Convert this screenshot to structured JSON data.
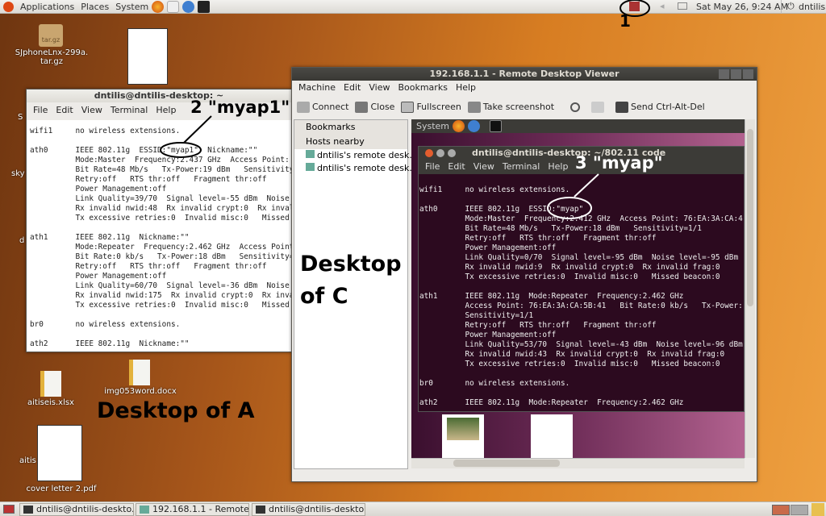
{
  "top_panel": {
    "menus": [
      "Applications",
      "Places",
      "System"
    ],
    "clock": "Sat May 26,  9:24 AM",
    "user": "dntilis"
  },
  "desktop": {
    "icons": [
      {
        "label": "SJphoneLnx-299a.\ntar.gz",
        "glyph": "tar.gz"
      },
      {
        "label": "aitiseis.xlsx"
      },
      {
        "label": "img053word.docx"
      },
      {
        "label": "cover letter 2.pdf"
      }
    ],
    "partial_labels": [
      "S",
      "sky",
      "d",
      "aitis"
    ]
  },
  "terminal_a": {
    "title": "dntilis@dntilis-desktop: ~",
    "menu": [
      "File",
      "Edit",
      "View",
      "Terminal",
      "Help"
    ],
    "lines": [
      "wifi1     no wireless extensions.",
      "",
      "ath0      IEEE 802.11g  ESSID:\"myap1\"  Nickname:\"\"",
      "          Mode:Master  Frequency:2.437 GHz  Access Point:",
      "          Bit Rate=48 Mb/s   Tx-Power:19 dBm   Sensitivity",
      "          Retry:off   RTS thr:off   Fragment thr:off",
      "          Power Management:off",
      "          Link Quality=39/70  Signal level=-55 dBm  Noise",
      "          Rx invalid nwid:48  Rx invalid crypt:0  Rx inval",
      "          Tx excessive retries:0  Invalid misc:0   Missed",
      "",
      "ath1      IEEE 802.11g  Nickname:\"\"",
      "          Mode:Repeater  Frequency:2.462 GHz  Access Point",
      "          Bit Rate:0 kb/s   Tx-Power:18 dBm   Sensitivity=",
      "          Retry:off   RTS thr:off   Fragment thr:off",
      "          Power Management:off",
      "          Link Quality=60/70  Signal level=-36 dBm  Noise",
      "          Rx invalid nwid:175  Rx invalid crypt:0  Rx inva",
      "          Tx excessive retries:0  Invalid misc:0   Missed",
      "",
      "br0       no wireless extensions.",
      "",
      "ath2      IEEE 802.11g  Nickname:\"\""
    ]
  },
  "viewer": {
    "title": "192.168.1.1 - Remote Desktop Viewer",
    "menu": [
      "Machine",
      "Edit",
      "View",
      "Bookmarks",
      "Help"
    ],
    "toolbar": [
      "Connect",
      "Close",
      "Fullscreen",
      "Take screenshot",
      "Send Ctrl-Alt-Del"
    ],
    "sidebar": {
      "headers": [
        "Bookmarks",
        "Hosts nearby"
      ],
      "hosts": [
        "dntilis's remote desk...",
        "dntilis's remote desk..."
      ]
    },
    "remote_panel": {
      "menu": "System"
    },
    "remote_terminal": {
      "title": "dntilis@dntilis-desktop: ~/802.11 code",
      "menu": [
        "File",
        "Edit",
        "View",
        "Terminal",
        "Help"
      ],
      "lines": [
        "wifi1     no wireless extensions.",
        "",
        "ath0      IEEE 802.11g  ESSID:\"myap\"",
        "          Mode:Master  Frequency:2.412 GHz  Access Point: 76:EA:3A:CA:4",
        "          Bit Rate=48 Mb/s   Tx-Power:18 dBm   Sensitivity=1/1",
        "          Retry:off   RTS thr:off   Fragment thr:off",
        "          Power Management:off",
        "          Link Quality=0/70  Signal level=-95 dBm  Noise level=-95 dBm",
        "          Rx invalid nwid:9  Rx invalid crypt:0  Rx invalid frag:0",
        "          Tx excessive retries:0  Invalid misc:0   Missed beacon:0",
        "",
        "ath1      IEEE 802.11g  Mode:Repeater  Frequency:2.462 GHz",
        "          Access Point: 76:EA:3A:CA:5B:41   Bit Rate:0 kb/s   Tx-Power:",
        "          Sensitivity=1/1",
        "          Retry:off   RTS thr:off   Fragment thr:off",
        "          Power Management:off",
        "          Link Quality=53/70  Signal level=-43 dBm  Noise level=-96 dBm",
        "          Rx invalid nwid:43  Rx invalid crypt:0  Rx invalid frag:0",
        "          Tx excessive retries:0  Invalid misc:0   Missed beacon:0",
        "",
        "br0       no wireless extensions.",
        "",
        "ath2      IEEE 802.11g  Mode:Repeater  Frequency:2.462 GHz"
      ]
    }
  },
  "annotations": {
    "a1": "1",
    "a2": "2 \"myap1\"",
    "a3": "3 \"myap\"",
    "desktop_c": "Desktop\nof C",
    "desktop_a": "Desktop of A"
  },
  "taskbar": [
    "dntilis@dntilis-deskto...",
    "192.168.1.1 - Remote ...",
    "dntilis@dntilis-deskto..."
  ],
  "colors": {
    "terminal_bg": "#2c0a1f",
    "panel": "#3c3b37",
    "accent": "#dd4814"
  }
}
